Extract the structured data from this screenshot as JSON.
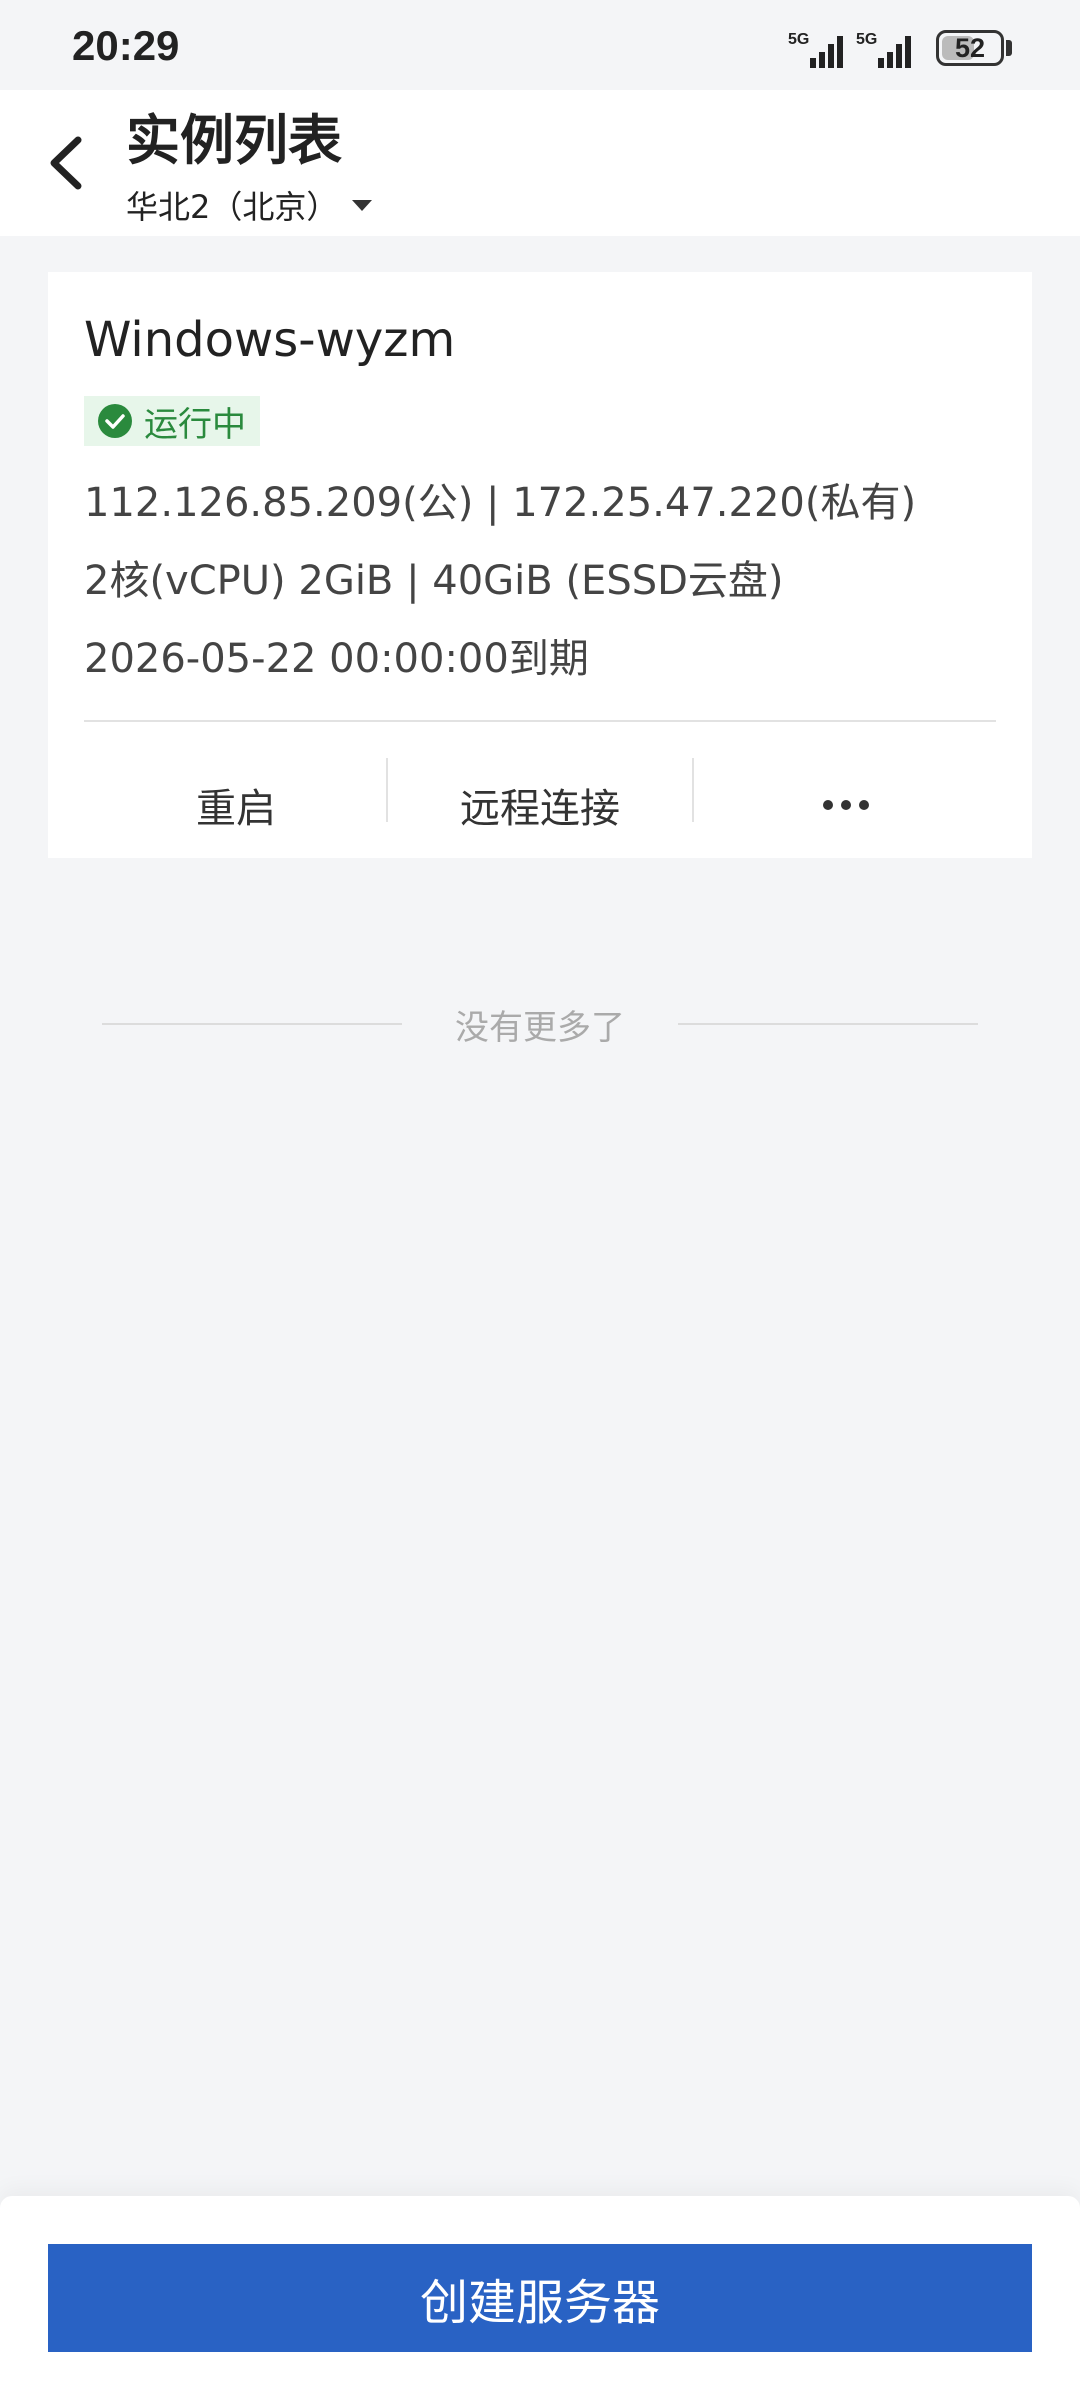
{
  "status_bar": {
    "time": "20:29",
    "signal_1_label": "5G",
    "signal_2_label": "5G",
    "battery": "52"
  },
  "header": {
    "title": "实例列表",
    "region": "华北2（北京）"
  },
  "instance": {
    "name": "Windows-wyzm",
    "status": "运行中",
    "ip": "112.126.85.209(公) | 172.25.47.220(私有)",
    "spec": "2核(vCPU) 2GiB | 40GiB (ESSD云盘)",
    "expiry": "2026-05-22 00:00:00到期",
    "actions": {
      "restart": "重启",
      "remote": "远程连接"
    }
  },
  "list_end": "没有更多了",
  "footer": {
    "create_label": "创建服务器"
  },
  "colors": {
    "primary": "#2962c4",
    "status_green": "#2a8a3d",
    "status_bg": "#e7f6ea",
    "page_bg": "#f4f5f7"
  }
}
